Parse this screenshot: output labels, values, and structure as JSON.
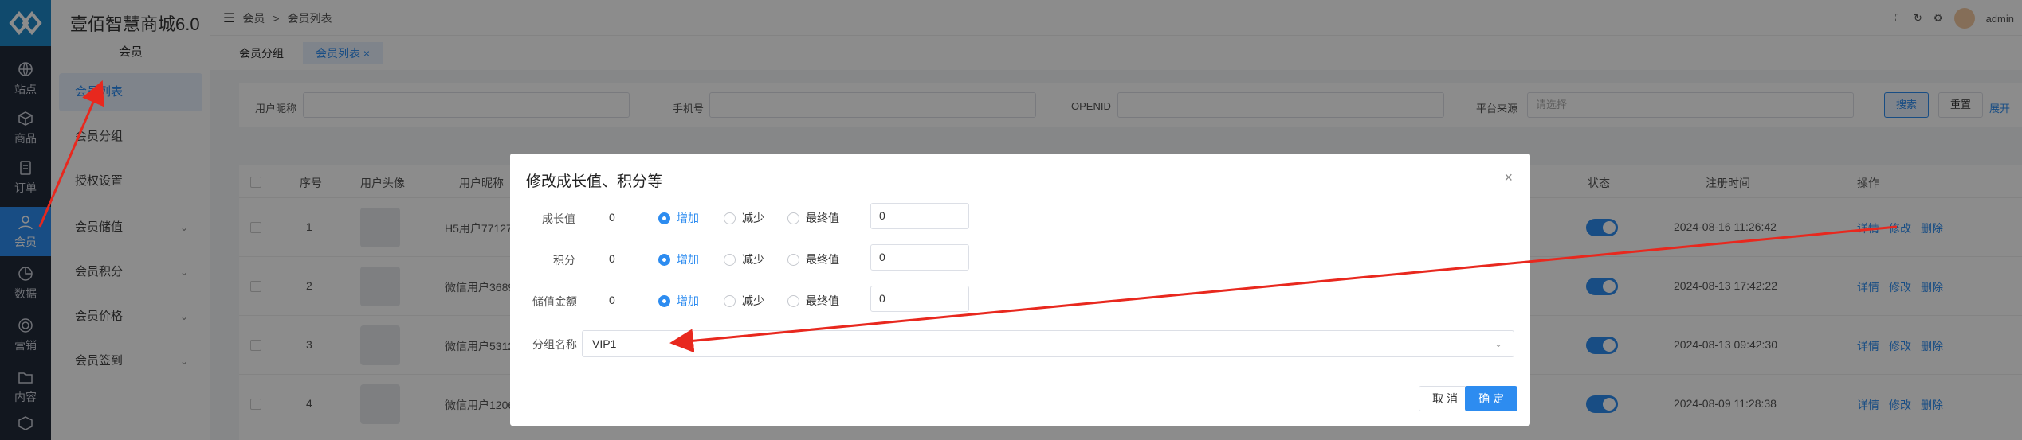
{
  "app": {
    "title": "壹佰智慧商城6.0"
  },
  "rail": {
    "items": [
      {
        "label": "站点",
        "icon": "globe-icon"
      },
      {
        "label": "商品",
        "icon": "box-icon"
      },
      {
        "label": "订单",
        "icon": "order-icon"
      },
      {
        "label": "会员",
        "icon": "user-icon",
        "active": true
      },
      {
        "label": "数据",
        "icon": "chart-icon"
      },
      {
        "label": "营销",
        "icon": "target-icon"
      },
      {
        "label": "内容",
        "icon": "folder-icon"
      }
    ]
  },
  "subbar": {
    "heading": "会员",
    "items": [
      {
        "label": "会员列表",
        "active": true
      },
      {
        "label": "会员分组"
      },
      {
        "label": "授权设置"
      },
      {
        "label": "会员储值",
        "expandable": true
      },
      {
        "label": "会员积分",
        "expandable": true
      },
      {
        "label": "会员价格",
        "expandable": true
      },
      {
        "label": "会员签到",
        "expandable": true
      }
    ]
  },
  "header": {
    "breadcrumb": [
      "会员",
      ">",
      "会员列表"
    ],
    "user": "admin"
  },
  "tabs": [
    {
      "label": "会员分组"
    },
    {
      "label": "会员列表",
      "active": true,
      "close": "×"
    }
  ],
  "filters": {
    "nickname_label": "用户昵称",
    "phone_label": "手机号",
    "openid_label": "OPENID",
    "platform_label": "平台来源",
    "platform_placeholder": "请选择",
    "search_button": "搜索",
    "reset_button": "重置",
    "expand_button": "展开"
  },
  "table": {
    "headers": {
      "seq": "序号",
      "avatar": "用户头像",
      "nickname": "用户昵称",
      "status": "状态",
      "reg_time": "注册时间",
      "actions": "操作"
    },
    "rows": [
      {
        "seq": "1",
        "nickname": "H5用户77127",
        "time": "2024-08-16 11:26:42"
      },
      {
        "seq": "2",
        "nickname": "微信用户3689",
        "time": "2024-08-13 17:42:22"
      },
      {
        "seq": "3",
        "nickname": "微信用户5312",
        "time": "2024-08-13 09:42:30"
      },
      {
        "seq": "4",
        "nickname": "微信用户1206",
        "time": "2024-08-09 11:28:38"
      }
    ],
    "actions": {
      "detail": "详情",
      "edit": "修改",
      "delete": "删除"
    }
  },
  "modal": {
    "title": "修改成长值、积分等",
    "close": "×",
    "fields": [
      {
        "label": "成长值",
        "value": "0",
        "input": "0"
      },
      {
        "label": "积分",
        "value": "0",
        "input": "0"
      },
      {
        "label": "储值金额",
        "value": "0",
        "input": "0"
      }
    ],
    "radios": {
      "add": "增加",
      "subtract": "减少",
      "final": "最终值"
    },
    "group_label": "分组名称",
    "group_value": "VIP1",
    "cancel": "取 消",
    "confirm": "确 定"
  },
  "colors": {
    "accent": "#2d8cf0",
    "rail": "#222a3a",
    "arrow": "#e8281e"
  }
}
